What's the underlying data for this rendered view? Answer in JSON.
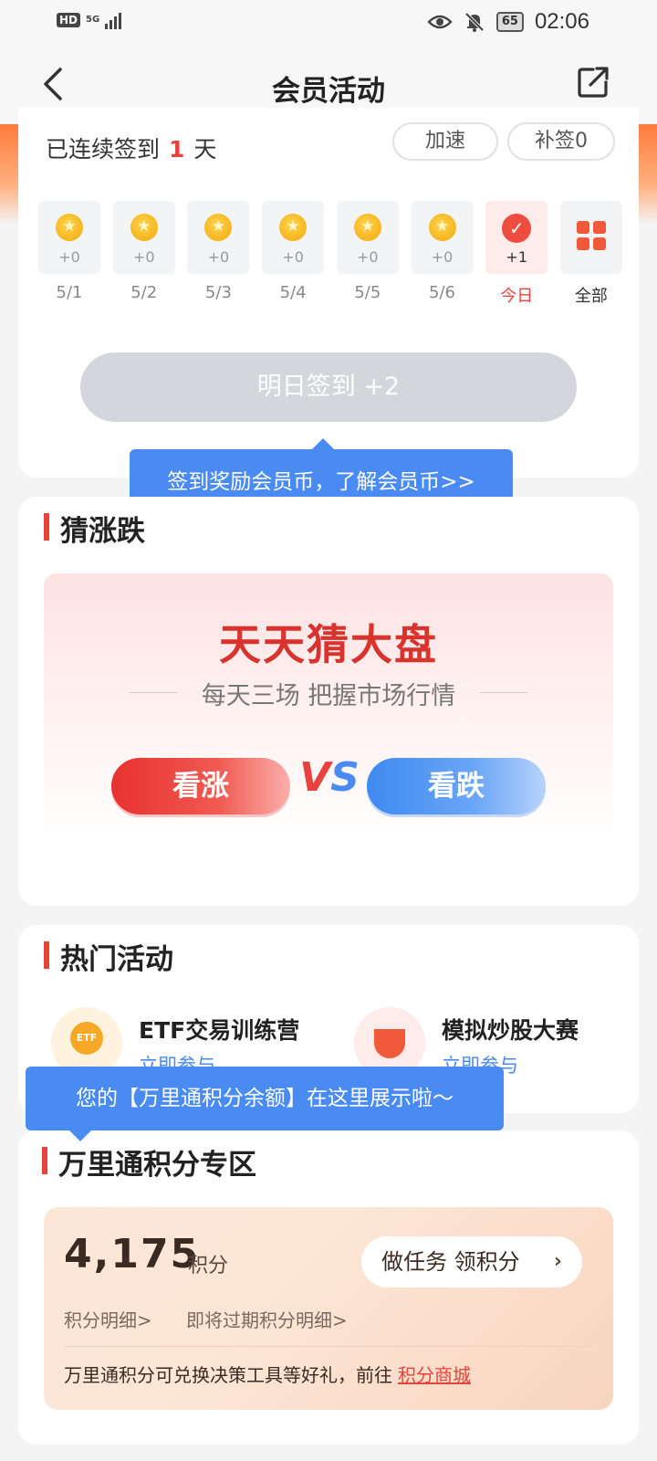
{
  "status_bar": {
    "hd": "HD",
    "network": "5G",
    "battery": "65",
    "time": "02:06"
  },
  "nav": {
    "title": "会员活动"
  },
  "signin": {
    "streak_prefix": "已连续签到",
    "streak_days": "1",
    "streak_suffix": "天",
    "speed_up_label": "加速",
    "makeup_label": "补签0",
    "days": [
      {
        "bonus": "+0",
        "date": "5/1"
      },
      {
        "bonus": "+0",
        "date": "5/2"
      },
      {
        "bonus": "+0",
        "date": "5/3"
      },
      {
        "bonus": "+0",
        "date": "5/4"
      },
      {
        "bonus": "+0",
        "date": "5/5"
      },
      {
        "bonus": "+0",
        "date": "5/6"
      },
      {
        "bonus": "+1",
        "date": "今日"
      }
    ],
    "all_label": "全部",
    "tomorrow_button": "明日签到 +2",
    "tooltip": "签到奖励会员币，了解会员币>>"
  },
  "guess": {
    "title": "猜涨跌",
    "banner_title": "天天猜大盘",
    "banner_subtitle": "每天三场 把握市场行情",
    "rise_label": "看涨",
    "vs_v": "V",
    "vs_s": "S",
    "fall_label": "看跌"
  },
  "hot": {
    "title": "热门活动",
    "items": [
      {
        "name": "ETF交易训练营",
        "action": "立即参与",
        "icon_text": "ETF"
      },
      {
        "name": "模拟炒股大赛",
        "action": "立即参与"
      }
    ]
  },
  "points": {
    "tooltip": "您的【万里通积分余额】在这里展示啦～",
    "title": "万里通积分专区",
    "value": "4,175",
    "unit": "积分",
    "task_button": "做任务 领积分",
    "task_arrow": "›",
    "detail_link": "积分明细>",
    "expire_link": "即将过期积分明细>",
    "note": "万里通积分可兑换决策工具等好礼，前往",
    "mall_link": "积分商城"
  },
  "colors": {
    "accent_red": "#e8423c",
    "accent_blue": "#4a8bf3",
    "orange": "#ff7a3c"
  }
}
